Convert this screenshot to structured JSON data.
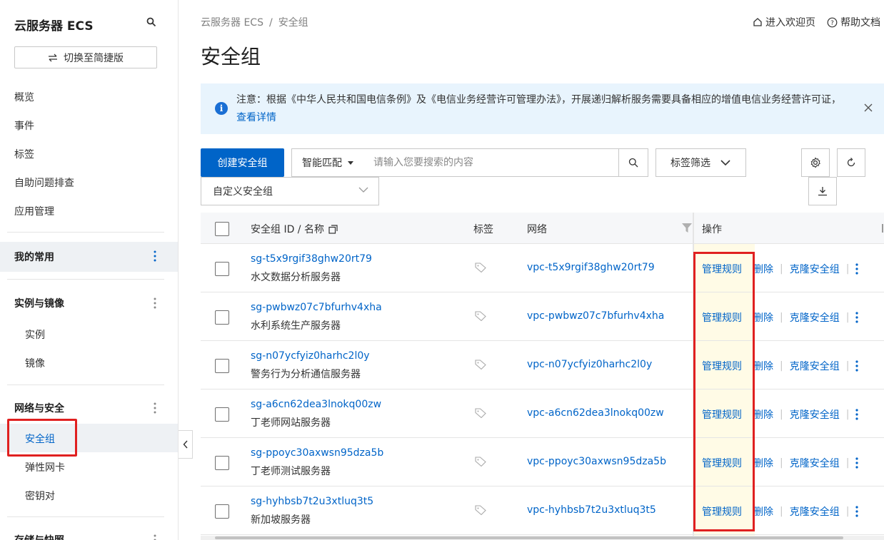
{
  "sidebar": {
    "title": "云服务器 ECS",
    "switch_label": "切换至简捷版",
    "top_items": [
      "概览",
      "事件",
      "标签",
      "自助问题排查",
      "应用管理"
    ],
    "favorites": "我的常用",
    "group_instances": "实例与镜像",
    "instances_items": [
      "实例",
      "镜像"
    ],
    "group_network": "网络与安全",
    "network_items": [
      "安全组",
      "弹性网卡",
      "密钥对"
    ],
    "group_storage": "存储与快照"
  },
  "header": {
    "breadcrumb": [
      "云服务器 ECS",
      "安全组"
    ],
    "welcome_link": "进入欢迎页",
    "help_link": "帮助文档",
    "page_title": "安全组"
  },
  "notice": {
    "text": "注意：根据《中华人民共和国电信条例》及《电信业务经营许可管理办法》，开展递归解析服务需要具备相应的增值电信业务经营许可证，",
    "link": "查看详情"
  },
  "toolbar": {
    "create_button": "创建安全组",
    "search_mode": "智能匹配",
    "search_placeholder": "请输入您要搜索的内容",
    "tag_filter": "标签筛选",
    "type_select": "自定义安全组"
  },
  "table": {
    "headers": {
      "id_name": "安全组 ID / 名称",
      "tags": "标签",
      "network": "网络",
      "actions": "操作"
    },
    "rows": [
      {
        "id": "sg-t5x9rgif38ghw20rt79",
        "name": "水文数据分析服务器",
        "vpc": "vpc-t5x9rgif38ghw20rt79"
      },
      {
        "id": "sg-pwbwz07c7bfurhv4xha",
        "name": "水利系统生产服务器",
        "vpc": "vpc-pwbwz07c7bfurhv4xha"
      },
      {
        "id": "sg-n07ycfyiz0harhc2l0y",
        "name": "警务行为分析通信服务器",
        "vpc": "vpc-n07ycfyiz0harhc2l0y"
      },
      {
        "id": "sg-a6cn62dea3lnokq00zw",
        "name": "丁老师网站服务器",
        "vpc": "vpc-a6cn62dea3lnokq00zw"
      },
      {
        "id": "sg-ppoyc30axwsn95dza5b",
        "name": "丁老师测试服务器",
        "vpc": "vpc-ppoyc30axwsn95dza5b"
      },
      {
        "id": "sg-hyhbsb7t2u3xtluq3t5",
        "name": "新加坡服务器",
        "vpc": "vpc-hyhbsb7t2u3xtluq3t5"
      }
    ],
    "actions": {
      "manage": "管理规则",
      "delete": "删除",
      "clone": "克隆安全组"
    }
  },
  "colors": {
    "primary": "#0064c8",
    "highlight_border": "#e02020",
    "notice_bg": "#e8f4fd"
  }
}
